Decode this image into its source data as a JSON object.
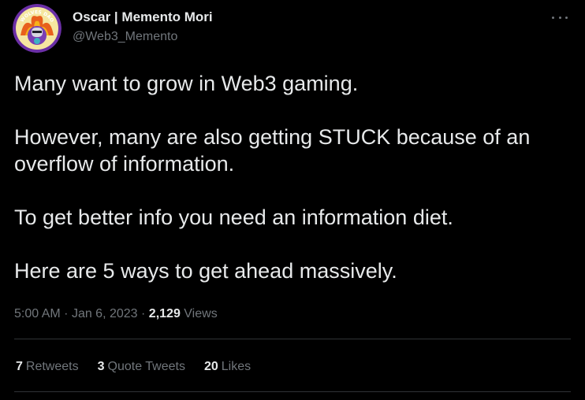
{
  "author": {
    "display_name": "Oscar | Memento Mori",
    "handle": "@Web3_Memento",
    "avatar_text": "WOLVES DAO"
  },
  "tweet": {
    "paragraphs": [
      "Many want to grow in Web3 gaming.",
      "However, many are also getting STUCK because of an overflow of information.",
      "To get better info you need an information diet.",
      "Here are 5 ways to get ahead massively."
    ]
  },
  "meta": {
    "time": "5:00 AM",
    "separator": "·",
    "date": "Jan 6, 2023",
    "views_count": "2,129",
    "views_label": "Views"
  },
  "stats": {
    "retweets_count": "7",
    "retweets_label": "Retweets",
    "quotes_count": "3",
    "quotes_label": "Quote Tweets",
    "likes_count": "20",
    "likes_label": "Likes"
  },
  "icons": {
    "more": "more-horizontal-icon"
  },
  "colors": {
    "background": "#000000",
    "primary_text": "#e7e9ea",
    "secondary_text": "#71767b",
    "divider": "#2f3336",
    "avatar_ring": "#6b2fa6"
  }
}
